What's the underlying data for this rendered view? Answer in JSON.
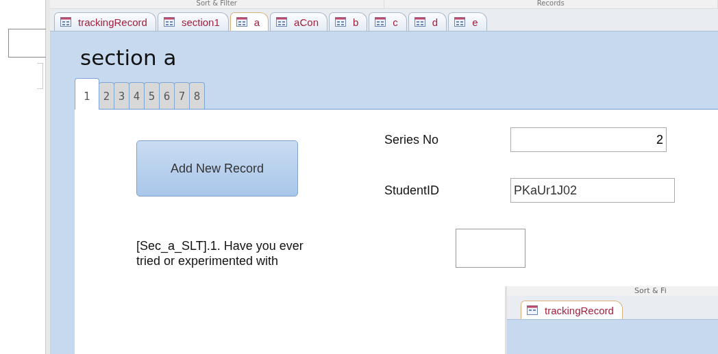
{
  "ribbon": {
    "groups": [
      "Sort & Filter",
      "Records"
    ]
  },
  "document_tabs": [
    {
      "label": "trackingRecord",
      "selected": false
    },
    {
      "label": "section1",
      "selected": false
    },
    {
      "label": "a",
      "selected": true
    },
    {
      "label": "aCon",
      "selected": false
    },
    {
      "label": "b",
      "selected": false
    },
    {
      "label": "c",
      "selected": false
    },
    {
      "label": "d",
      "selected": false
    },
    {
      "label": "e",
      "selected": false
    }
  ],
  "form": {
    "title": "section a",
    "page_tabs": [
      {
        "label": "1",
        "selected": true
      },
      {
        "label": "2",
        "selected": false
      },
      {
        "label": "3",
        "selected": false
      },
      {
        "label": "4",
        "selected": false
      },
      {
        "label": "5",
        "selected": false
      },
      {
        "label": "6",
        "selected": false
      },
      {
        "label": "7",
        "selected": false
      },
      {
        "label": "8",
        "selected": false
      }
    ],
    "add_button": "Add New Record",
    "fields": [
      {
        "label": "Series No",
        "value": "2",
        "kind": "number"
      },
      {
        "label": "StudentID",
        "value": "PKaUr1J02",
        "kind": "text"
      }
    ],
    "question": "[Sec_a_SLT].1. Have you ever tried or experimented with"
  },
  "overlay_window": {
    "ribbon_group": "Sort & Fi",
    "tab": "trackingRecord"
  }
}
